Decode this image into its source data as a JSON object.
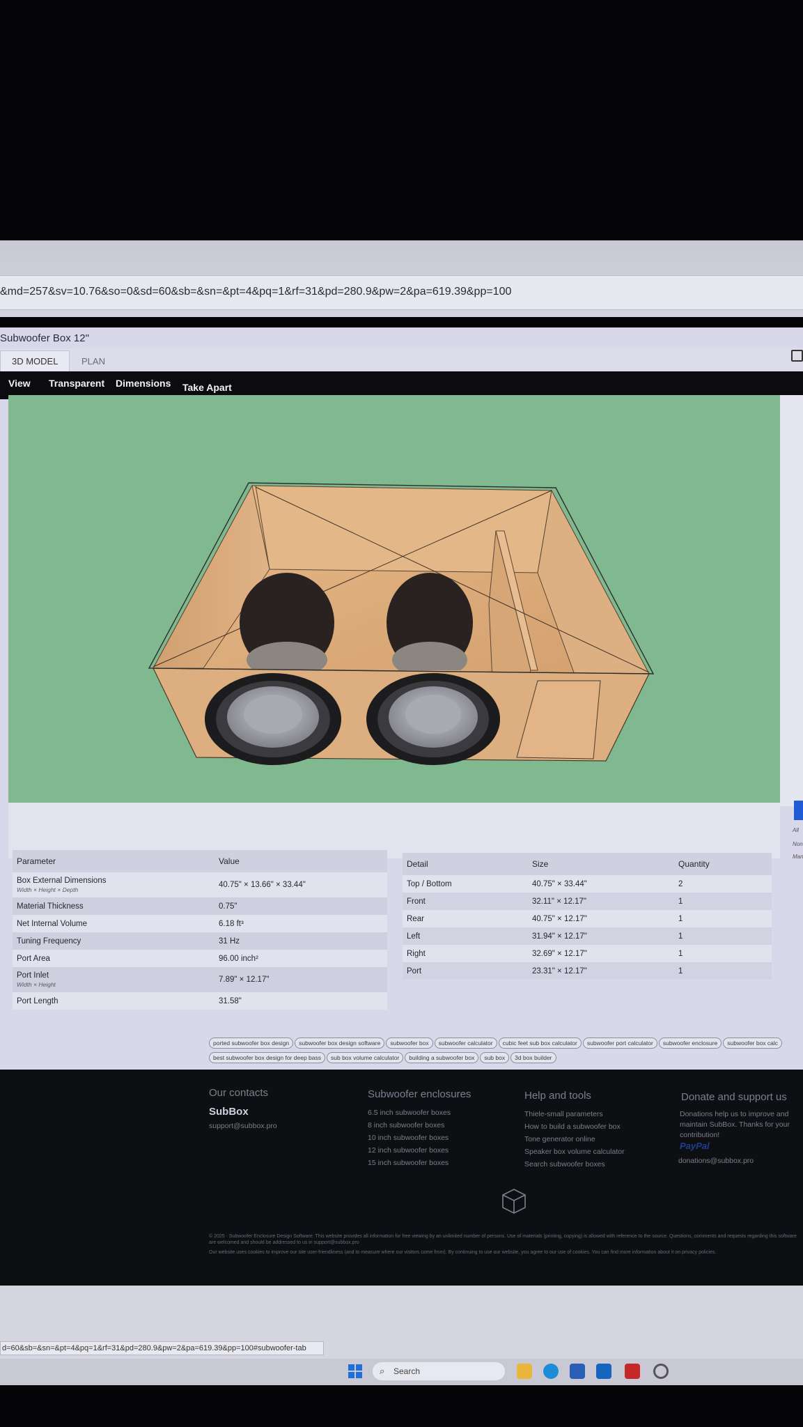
{
  "browser": {
    "url": "&md=257&sv=10.76&so=0&sd=60&sb=&sn=&pt=4&pq=1&rf=31&pd=280.9&pw=2&pa=619.39&pp=100",
    "status_url": "d=60&sb=&sn=&pt=4&pq=1&rf=31&pd=280.9&pw=2&pa=619.39&pp=100#subwoofer-tab"
  },
  "app": {
    "title": "Subwoofer Box 12\"",
    "tabs": [
      "3D MODEL",
      "PLAN"
    ],
    "viewer_menu": [
      "View",
      "Transparent",
      "Dimensions",
      "Take Apart"
    ]
  },
  "params": {
    "header": [
      "Parameter",
      "Value"
    ],
    "rows": [
      {
        "name": "Box External Dimensions",
        "sub": "Width × Height × Depth",
        "value": "40.75\" × 13.66\" × 33.44\""
      },
      {
        "name": "Material Thickness",
        "sub": "",
        "value": "0.75\""
      },
      {
        "name": "Net Internal Volume",
        "sub": "",
        "value": "6.18 ft³"
      },
      {
        "name": "Tuning Frequency",
        "sub": "",
        "value": "31 Hz"
      },
      {
        "name": "Port Area",
        "sub": "",
        "value": "96.00 inch²"
      },
      {
        "name": "Port Inlet",
        "sub": "Width × Height",
        "value": "7.89\" × 12.17\""
      },
      {
        "name": "Port Length",
        "sub": "",
        "value": "31.58\""
      }
    ]
  },
  "details": {
    "header": [
      "Detail",
      "Size",
      "Quantity"
    ],
    "rows": [
      {
        "detail": "Top / Bottom",
        "size": "40.75\" × 33.44\"",
        "qty": "2"
      },
      {
        "detail": "Front",
        "size": "32.11\" × 12.17\"",
        "qty": "1"
      },
      {
        "detail": "Rear",
        "size": "40.75\" × 12.17\"",
        "qty": "1"
      },
      {
        "detail": "Left",
        "size": "31.94\" × 12.17\"",
        "qty": "1"
      },
      {
        "detail": "Right",
        "size": "32.69\" × 12.17\"",
        "qty": "1"
      },
      {
        "detail": "Port",
        "size": "23.31\" × 12.17\"",
        "qty": "1"
      }
    ]
  },
  "side_panel_text": [
    "All",
    "Non",
    "Man"
  ],
  "tags": [
    "ported subwoofer box design",
    "subwoofer box design software",
    "subwoofer box",
    "subwoofer calculator",
    "cubic feet sub box calculator",
    "subwoofer port calculator",
    "subwoofer enclosure",
    "subwoofer box calc",
    "best subwoofer box design for deep bass",
    "sub box volume calculator",
    "building a subwoofer box",
    "sub box",
    "3d box builder"
  ],
  "footer": {
    "contacts": {
      "heading": "Our contacts",
      "brand": "SubBox",
      "email": "support@subbox.pro"
    },
    "enclosures": {
      "heading": "Subwoofer enclosures",
      "links": [
        "6.5 inch subwoofer boxes",
        "8 inch subwoofer boxes",
        "10 inch subwoofer boxes",
        "12 inch subwoofer boxes",
        "15 inch subwoofer boxes"
      ]
    },
    "help": {
      "heading": "Help and tools",
      "links": [
        "Thiele-small parameters",
        "How to build a subwoofer box",
        "Tone generator online",
        "Speaker box volume calculator",
        "Search subwoofer boxes"
      ]
    },
    "donate": {
      "heading": "Donate and support us",
      "text": "Donations help us to improve and maintain SubBox. Thanks for your contribution!",
      "paypal": "PayPal",
      "email": "donations@subbox.pro"
    },
    "legal1": "© 2025 · Subwoofer Enclosure Design Software. This website provides all information for free viewing by an unlimited number of persons. Use of materials (printing, copying) is allowed with reference to the source. Questions, comments and requests regarding this software are welcomed and should be addressed to us in support@subbox.pro",
    "legal2": "Our website uses cookies to improve our site user-friendliness (and to measure where our visitors come from). By continuing to use our website, you agree to our use of cookies. You can find more information about it on privacy policies."
  },
  "taskbar": {
    "search_label": "Search"
  }
}
